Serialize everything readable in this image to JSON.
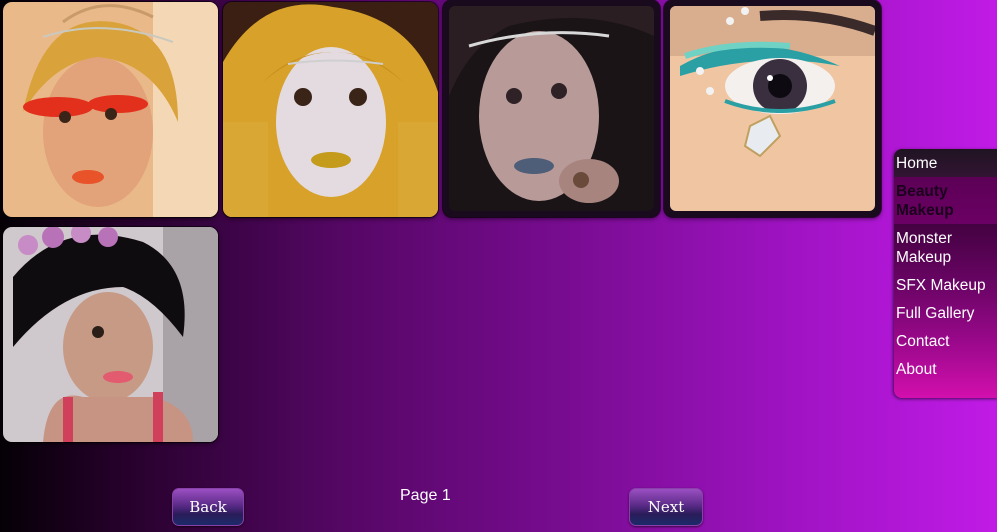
{
  "gallery": {
    "photos": [
      {
        "alt": "Beauty makeup portrait with gold hair, red feather lashes and orange lips"
      },
      {
        "alt": "Golden wig portrait with gold lips"
      },
      {
        "alt": "Dark portrait with gems and silver lips"
      },
      {
        "alt": "Close-up eye with teal glitter and pearl gems"
      },
      {
        "alt": "Portrait with flower crown and pink lips"
      }
    ]
  },
  "nav": {
    "items": [
      {
        "label": "Home"
      },
      {
        "label": "Beauty Makeup"
      },
      {
        "label": "Monster Makeup"
      },
      {
        "label": "SFX Makeup"
      },
      {
        "label": "Full Gallery"
      },
      {
        "label": "Contact"
      },
      {
        "label": "About"
      }
    ]
  },
  "pager": {
    "back_label": "Back",
    "page_label": "Page 1",
    "next_label": "Next"
  },
  "colors": {
    "background_left": "#050006",
    "background_right": "#c01be6",
    "nav_bottom": "#d20fad"
  }
}
